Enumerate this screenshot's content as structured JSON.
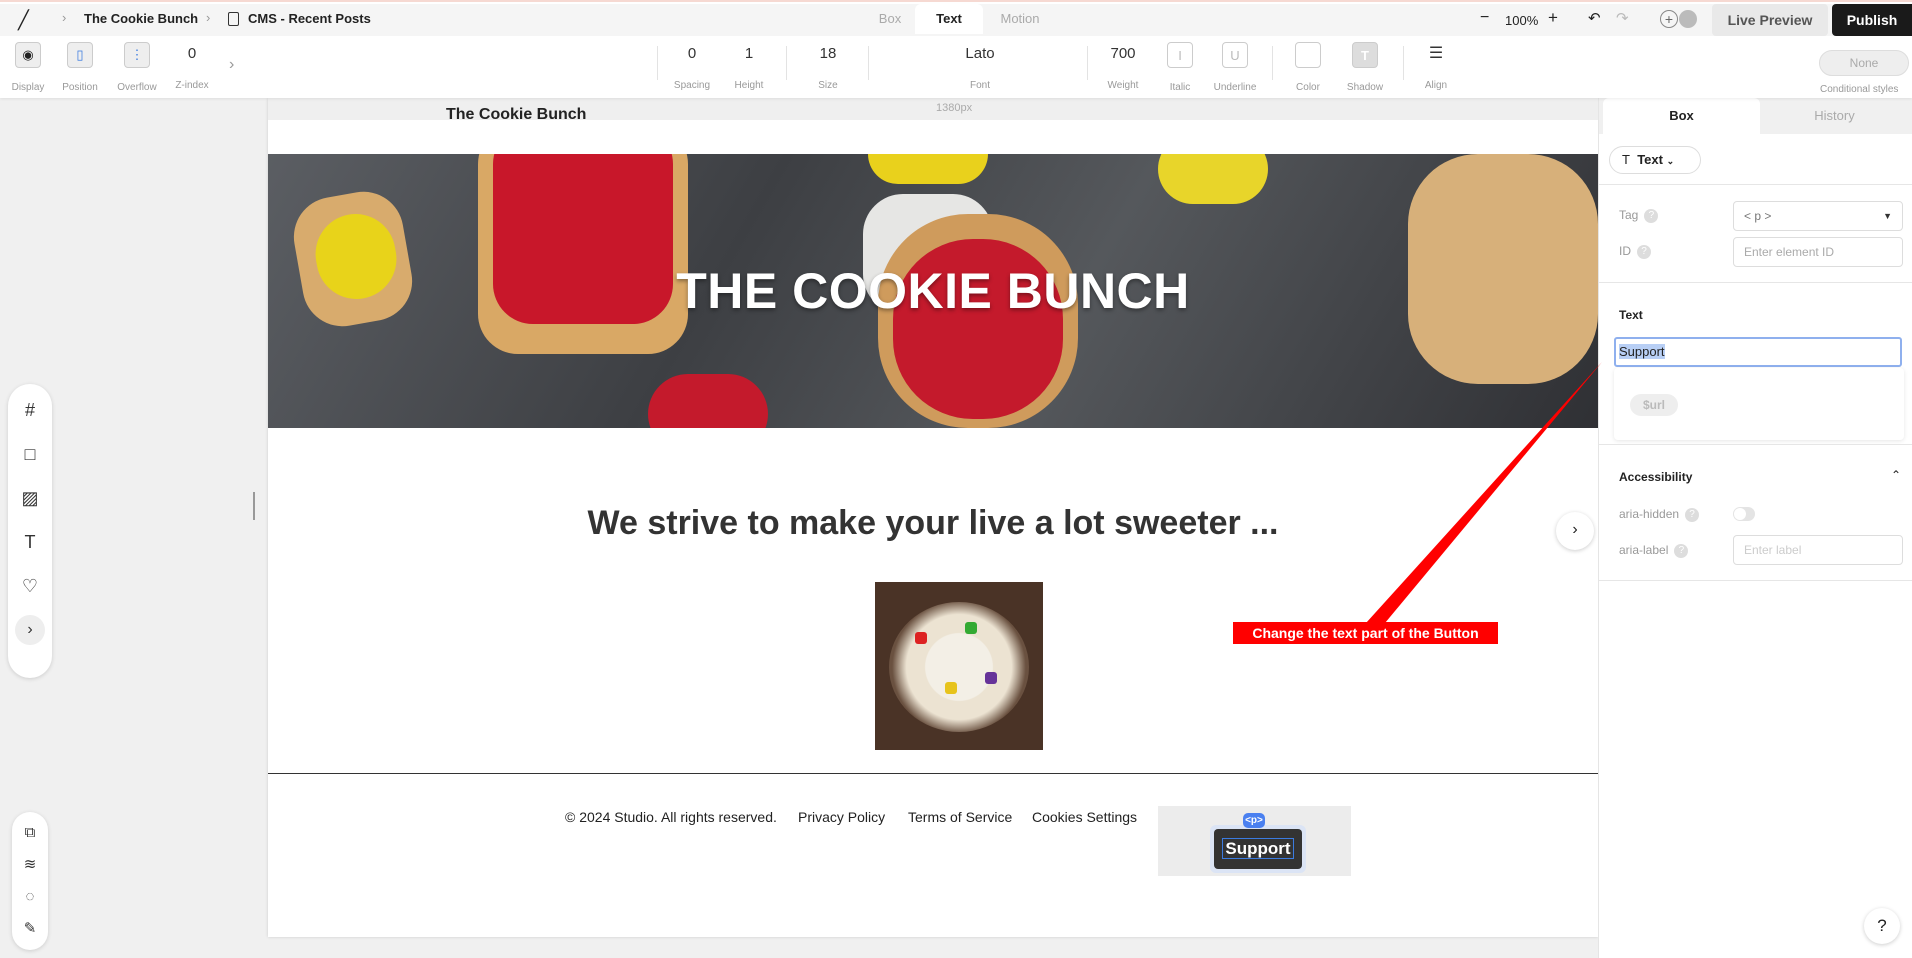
{
  "topbar": {
    "breadcrumb": [
      "The Cookie Bunch",
      "CMS - Recent Posts"
    ],
    "mode_tabs": [
      {
        "label": "Box",
        "active": false
      },
      {
        "label": "Text",
        "active": true
      },
      {
        "label": "Motion",
        "active": false
      }
    ],
    "zoom": "100%",
    "live_preview": "Live Preview",
    "publish": "Publish"
  },
  "toolbar": {
    "display": "Display",
    "position": "Position",
    "overflow": "Overflow",
    "zindex_label": "Z-index",
    "zindex": "0",
    "spacing": "0",
    "spacing_label": "Spacing",
    "height": "1",
    "height_label": "Height",
    "size": "18",
    "size_label": "Size",
    "font": "Lato",
    "font_label": "Font",
    "weight": "700",
    "weight_label": "Weight",
    "italic_label": "Italic",
    "underline_label": "Underline",
    "color_label": "Color",
    "shadow_label": "Shadow",
    "align_label": "Align",
    "conditional": "None",
    "conditional_label": "Conditional styles"
  },
  "canvas": {
    "width_label": "1380px",
    "site_name": "The Cookie Bunch",
    "hero_title": "THE COOKIE BUNCH",
    "tagline": "We strive to make your live a lot sweeter ...",
    "footer": {
      "copyright": "© 2024 Studio. All rights reserved.",
      "links": [
        "Privacy Policy",
        "Terms of Service",
        "Cookies Settings"
      ],
      "button": "Support",
      "tag_badge": "<p>"
    }
  },
  "annotation": {
    "text": "Change the text part of the Button",
    "color": "#ff0000"
  },
  "panel": {
    "tabs": [
      {
        "label": "Box",
        "active": true
      },
      {
        "label": "History",
        "active": false
      }
    ],
    "element_type": "Text",
    "tag_label": "Tag",
    "tag_value": "< p >",
    "id_label": "ID",
    "id_placeholder": "Enter element ID",
    "text_section": "Text",
    "text_value": "Support",
    "suggestion": "$url",
    "accessibility": "Accessibility",
    "aria_hidden": "aria-hidden",
    "aria_hidden_on": false,
    "aria_label": "aria-label",
    "aria_label_placeholder": "Enter label"
  },
  "help": "?"
}
